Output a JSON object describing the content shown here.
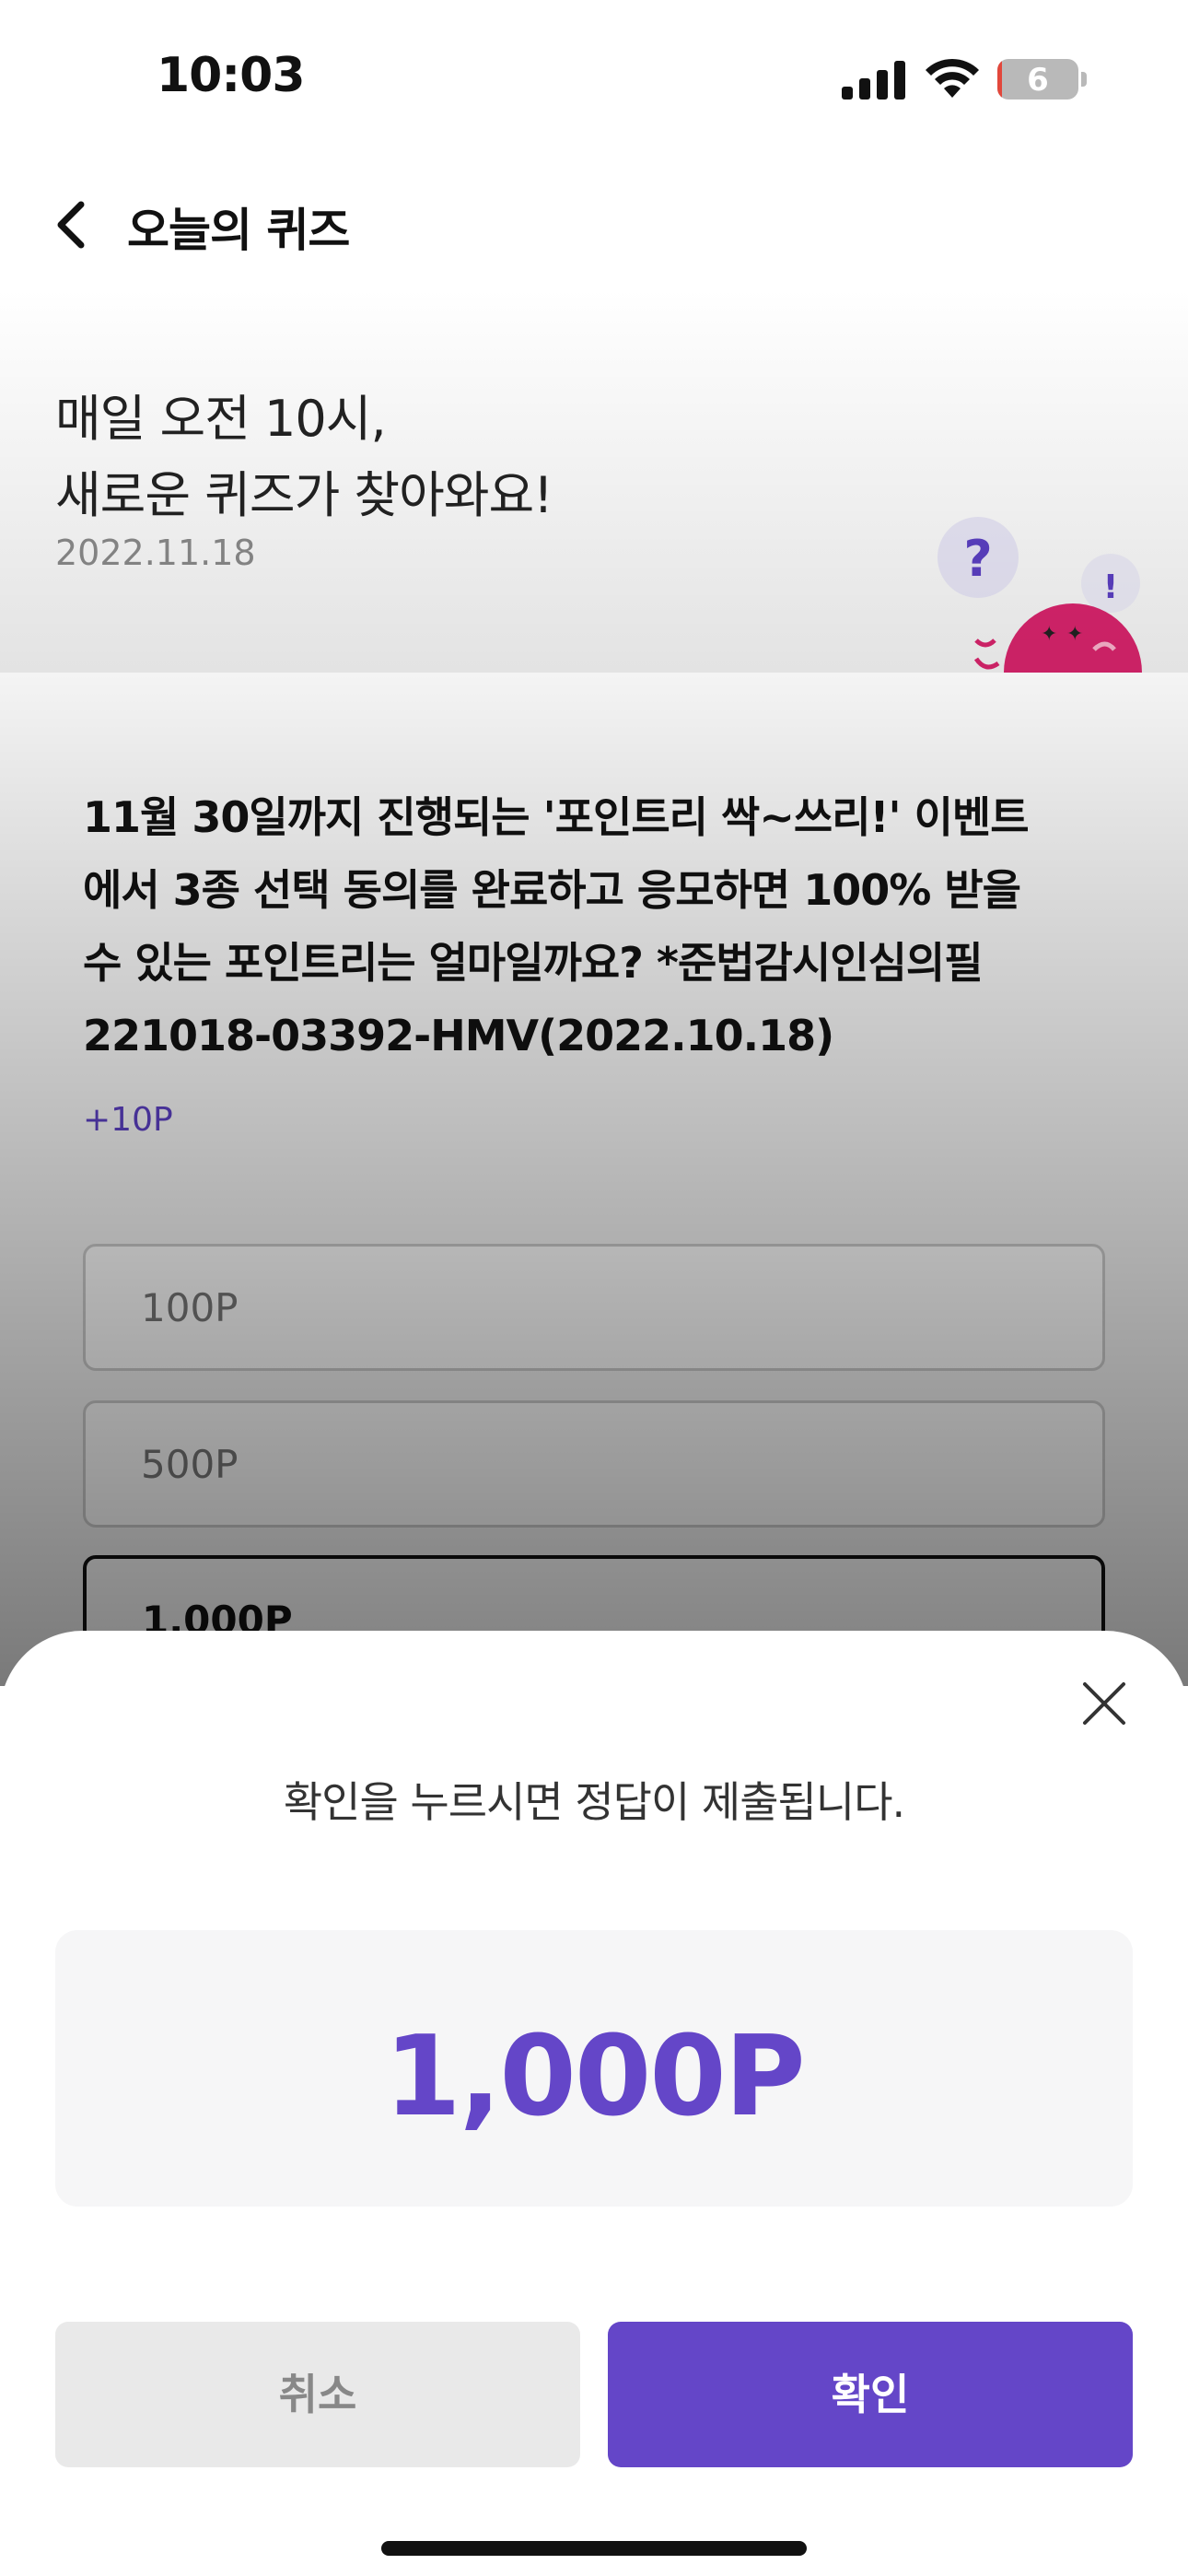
{
  "status_bar": {
    "time": "10:03",
    "battery_level": "6",
    "icons": [
      "signal-icon",
      "wifi-icon",
      "battery-icon"
    ]
  },
  "nav": {
    "title": "오늘의 퀴즈",
    "back_icon": "chevron-left-icon"
  },
  "header": {
    "line1": "매일 오전 10시,",
    "line2": "새로운 퀴즈가 찾아와요!",
    "date": "2022.11.18",
    "mascot_marks": [
      "?",
      "!"
    ]
  },
  "quiz": {
    "question_lines": [
      "11월 30일까지 진행되는 '포인트리 싹~쓰리!' 이벤트",
      "에서 3종 선택 동의를 완료하고 응모하면 100% 받을",
      "수 있는 포인트리는 얼마일까요? *준법감시인심의필",
      "221018-03392-HMV(2022.10.18)"
    ],
    "reward": "+10P",
    "options": [
      "100P",
      "500P",
      "1,000P"
    ],
    "selected_index": 2
  },
  "sheet": {
    "message": "확인을 누르시면 정답이 제출됩니다.",
    "selected_answer": "1,000P",
    "cancel_label": "취소",
    "confirm_label": "확인",
    "close_icon": "close-icon"
  },
  "colors": {
    "accent": "#6446c8",
    "mascot": "#d6246b"
  }
}
